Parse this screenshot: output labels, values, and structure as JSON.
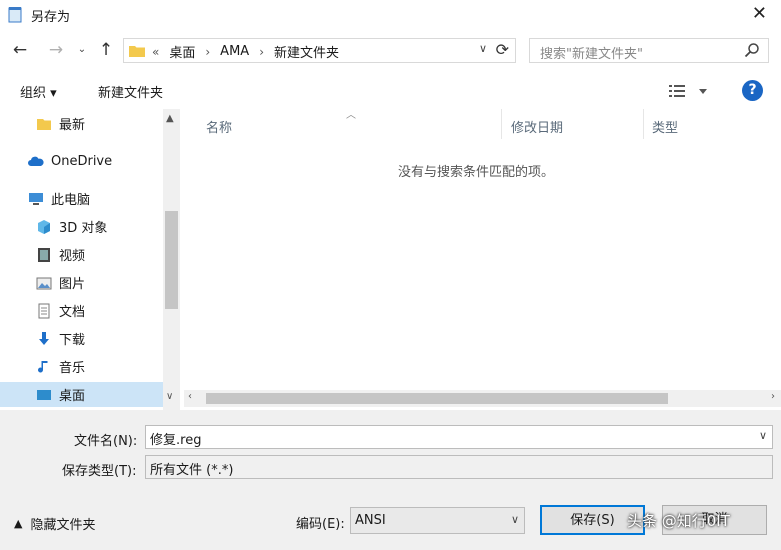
{
  "window": {
    "title": "另存为"
  },
  "nav": {
    "back": "←",
    "forward": "→",
    "recent": "⌄",
    "up": "↑",
    "breadcrumbs": [
      "«",
      "桌面",
      "›",
      "AMA",
      "›",
      "新建文件夹"
    ],
    "refresh": "⟳"
  },
  "search": {
    "placeholder": "搜索\"新建文件夹\""
  },
  "toolbar": {
    "organize": "组织 ▾",
    "new_folder": "新建文件夹",
    "help": "?"
  },
  "sidebar": {
    "items": [
      {
        "label": "最新",
        "icon": "folder-icon"
      },
      {
        "label": "OneDrive",
        "icon": "cloud-icon"
      },
      {
        "label": "此电脑",
        "icon": "computer-icon"
      },
      {
        "label": "3D 对象",
        "icon": "cube-icon"
      },
      {
        "label": "视频",
        "icon": "video-icon"
      },
      {
        "label": "图片",
        "icon": "picture-icon"
      },
      {
        "label": "文档",
        "icon": "document-icon"
      },
      {
        "label": "下载",
        "icon": "download-icon"
      },
      {
        "label": "音乐",
        "icon": "music-icon"
      },
      {
        "label": "桌面",
        "icon": "desktop-icon"
      }
    ]
  },
  "columns": [
    "名称",
    "修改日期",
    "类型"
  ],
  "content": {
    "empty_message": "没有与搜索条件匹配的项。"
  },
  "form": {
    "filename_label": "文件名(N):",
    "filename_value": "修复.reg",
    "type_label": "保存类型(T):",
    "type_value": "所有文件 (*.*)",
    "hide_folders": "隐藏文件夹",
    "encoding_label": "编码(E):",
    "encoding_value": "ANSI",
    "save": "保存(S)",
    "cancel": "取消"
  },
  "watermark": "头条 @知行0IT",
  "colors": {
    "accent": "#0078d7",
    "selection": "#cce4f7",
    "help": "#1a66c4"
  }
}
